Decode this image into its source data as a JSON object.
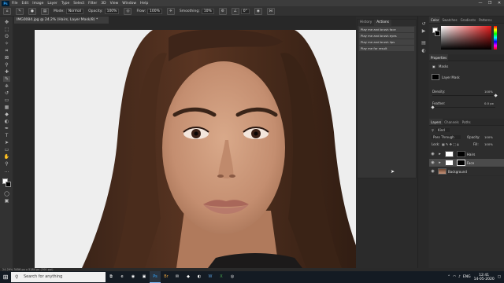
{
  "app": {
    "logo": "Ps",
    "menu": [
      "File",
      "Edit",
      "Image",
      "Layer",
      "Type",
      "Select",
      "Filter",
      "3D",
      "View",
      "Window",
      "Help"
    ],
    "window_controls": [
      "—",
      "❐",
      "✕"
    ]
  },
  "options_bar": {
    "mode_label": "Mode:",
    "mode_value": "Normal",
    "opacity_label": "Opacity:",
    "opacity_value": "100%",
    "flow_label": "Flow:",
    "flow_value": "100%",
    "smoothing_label": "Smoothing:",
    "smoothing_value": "10%",
    "angle_value": "0°"
  },
  "document": {
    "tab_title": "IMG0084.jpg @ 24.2% (Hairs, Layer Mask/8) *",
    "status": "24.29%    3456 px x 5184 px (300 ppi)"
  },
  "actions_panel": {
    "tabs": [
      "History",
      "Actions"
    ],
    "active_tab": "Actions",
    "items": [
      "Play me and brush face",
      "Play me and brush eyes",
      "Play me and brush lips",
      "Play me for result"
    ]
  },
  "color_panel": {
    "tabs": [
      "Color",
      "Swatches",
      "Gradients",
      "Patterns"
    ],
    "foreground": "#ffffff",
    "background": "#000000",
    "hue_color": "#e31b1b"
  },
  "properties_panel": {
    "tabs": [
      "Properties"
    ],
    "masks_label": "Masks",
    "layer_mask_label": "Layer Mask",
    "density_label": "Density:",
    "density_value": "100%",
    "feather_label": "Feather:",
    "feather_value": "0.0 px",
    "density_fraction": 1.0,
    "feather_fraction": 0.0
  },
  "layers_panel": {
    "tabs": [
      "Layers",
      "Channels",
      "Paths"
    ],
    "kind_label": "Kind",
    "blend_mode": "Pass Through",
    "opacity_label": "Opacity:",
    "opacity_value": "100%",
    "lock_label": "Lock:",
    "fill_label": "Fill:",
    "fill_value": "100%",
    "layers": [
      {
        "name": "Hairs",
        "selected": false,
        "type": "group"
      },
      {
        "name": "Face",
        "selected": true,
        "type": "group"
      },
      {
        "name": "Background",
        "selected": false,
        "type": "image"
      }
    ]
  },
  "taskbar": {
    "start": "⊞",
    "search_placeholder": "Search for anything",
    "apps": [
      "⧉",
      "e",
      "◉",
      "▣",
      "Ps",
      "Br",
      "✉",
      "◆",
      "◐",
      "W",
      "X",
      "◎"
    ],
    "time": "12:41",
    "date": "14-05-2020",
    "language": "ENG"
  }
}
